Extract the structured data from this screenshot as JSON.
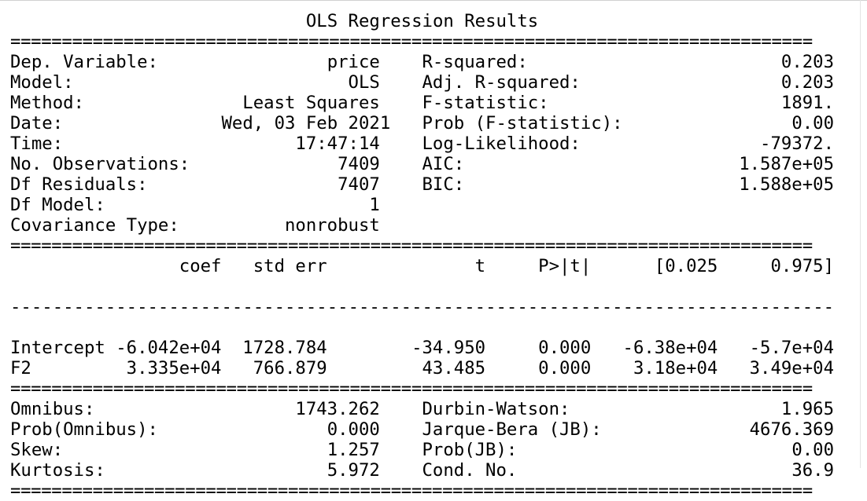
{
  "title": "OLS Regression Results",
  "rule_eq": "==============================================================================",
  "rule_dash": "------------------------------------------------------------------------------",
  "header_left": [
    {
      "label": "Dep. Variable:",
      "value": "price"
    },
    {
      "label": "Model:",
      "value": "OLS"
    },
    {
      "label": "Method:",
      "value": "Least Squares"
    },
    {
      "label": "Date:",
      "value": "Wed, 03 Feb 2021"
    },
    {
      "label": "Time:",
      "value": "17:47:14"
    },
    {
      "label": "No. Observations:",
      "value": "7409"
    },
    {
      "label": "Df Residuals:",
      "value": "7407"
    },
    {
      "label": "Df Model:",
      "value": "1"
    },
    {
      "label": "Covariance Type:",
      "value": "nonrobust"
    }
  ],
  "header_right": [
    {
      "label": "R-squared:",
      "value": "0.203"
    },
    {
      "label": "Adj. R-squared:",
      "value": "0.203"
    },
    {
      "label": "F-statistic:",
      "value": "1891."
    },
    {
      "label": "Prob (F-statistic):",
      "value": "0.00"
    },
    {
      "label": "Log-Likelihood:",
      "value": "-79372."
    },
    {
      "label": "AIC:",
      "value": "1.587e+05"
    },
    {
      "label": "BIC:",
      "value": "1.588e+05"
    }
  ],
  "coef_table": {
    "columns": [
      "coef",
      "std err",
      "t",
      "P>|t|",
      "[0.025",
      "0.975]"
    ],
    "rows": [
      {
        "name": "Intercept",
        "values": [
          "-6.042e+04",
          "1728.784",
          "-34.950",
          "0.000",
          "-6.38e+04",
          "-5.7e+04"
        ]
      },
      {
        "name": "F2",
        "values": [
          "3.335e+04",
          "766.879",
          "43.485",
          "0.000",
          "3.18e+04",
          "3.49e+04"
        ]
      }
    ]
  },
  "footer_left": [
    {
      "label": "Omnibus:",
      "value": "1743.262"
    },
    {
      "label": "Prob(Omnibus):",
      "value": "0.000"
    },
    {
      "label": "Skew:",
      "value": "1.257"
    },
    {
      "label": "Kurtosis:",
      "value": "5.972"
    }
  ],
  "footer_right": [
    {
      "label": "Durbin-Watson:",
      "value": "1.965"
    },
    {
      "label": "Jarque-Bera (JB):",
      "value": "4676.369"
    },
    {
      "label": "Prob(JB):",
      "value": "0.00"
    },
    {
      "label": "Cond. No.",
      "value": "36.9"
    }
  ]
}
